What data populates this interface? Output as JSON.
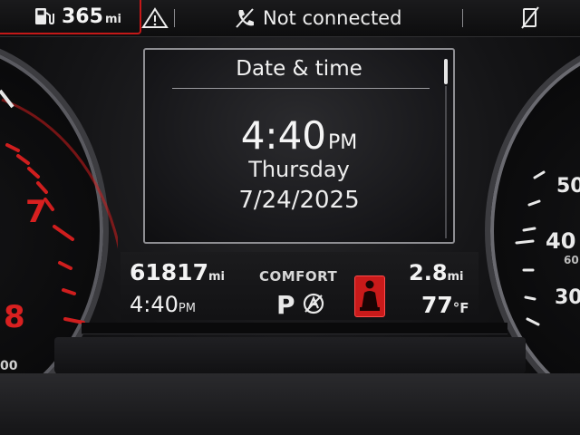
{
  "topbar": {
    "range_value": "365",
    "range_unit": "mi",
    "status_text": "Not connected"
  },
  "screen": {
    "title": "Date & time",
    "time": "4:40",
    "ampm": "PM",
    "weekday": "Thursday",
    "date": "7/24/2025"
  },
  "info": {
    "odometer_value": "61817",
    "odometer_unit": "mi",
    "clock_value": "4:40",
    "clock_unit": "PM",
    "drive_mode": "COMFORT",
    "gear": "P",
    "trip_value": "2.8",
    "trip_unit": "mi",
    "temp_value": "77",
    "temp_unit": "°F"
  },
  "gauges": {
    "tach_labels": [
      "7",
      "8"
    ],
    "speedo_labels": [
      "50",
      "40",
      "60",
      "30"
    ],
    "tach_extra": "00"
  },
  "colors": {
    "redline": "#c41818",
    "warning_red": "#c91a1a",
    "text": "#f2f2f2"
  }
}
